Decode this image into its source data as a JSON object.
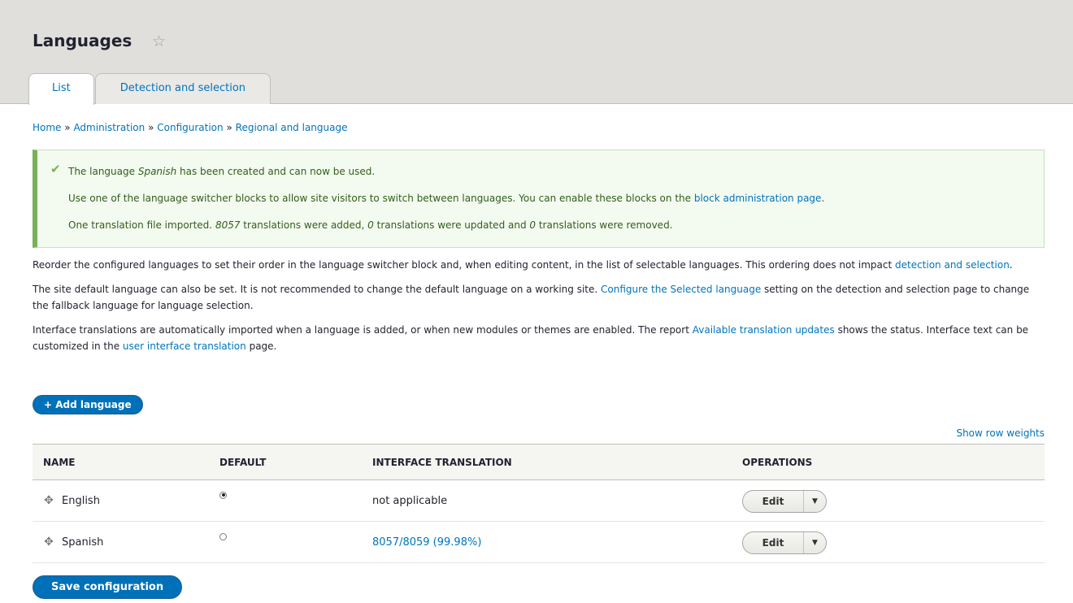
{
  "page": {
    "title": "Languages",
    "star_icon": "☆"
  },
  "tabs": [
    {
      "label": "List",
      "active": true
    },
    {
      "label": "Detection and selection",
      "active": false
    }
  ],
  "breadcrumb": [
    {
      "label": "Home"
    },
    {
      "label": "Administration"
    },
    {
      "label": "Configuration"
    },
    {
      "label": "Regional and language"
    }
  ],
  "breadcrumb_separator": "»",
  "message": {
    "icon": "check-icon",
    "line1_pre": "The language ",
    "line1_lang": "Spanish",
    "line1_post": " has been created and can now be used.",
    "line2_pre": "Use one of the language switcher blocks to allow site visitors to switch between languages. You can enable these blocks on the ",
    "line2_link": "block administration page",
    "line2_post": ".",
    "line3_a": "One translation file imported. ",
    "line3_added": "8057",
    "line3_b": " translations were added, ",
    "line3_updated": "0",
    "line3_c": " translations were updated and ",
    "line3_removed": "0",
    "line3_d": " translations were removed."
  },
  "intro": {
    "p1_text": "Reorder the configured languages to set their order in the language switcher block and, when editing content, in the list of selectable languages. This ordering does not impact ",
    "p1_link": "detection and selection",
    "p1_end": ".",
    "p2_text": "The site default language can also be set. It is not recommended to change the default language on a working site. ",
    "p2_link": "Configure the Selected language",
    "p2_end": " setting on the detection and selection page to change the fallback language for language selection.",
    "p3_text": "Interface translations are automatically imported when a language is added, or when new modules or themes are enabled. The report ",
    "p3_link": "Available translation updates",
    "p3_mid": " shows the status. Interface text can be customized in the ",
    "p3_link2": "user interface translation",
    "p3_end": " page."
  },
  "add_language_label": "+ Add language",
  "show_row_weights_label": "Show row weights",
  "table": {
    "headers": [
      "NAME",
      "DEFAULT",
      "INTERFACE TRANSLATION",
      "OPERATIONS"
    ],
    "rows": [
      {
        "name": "English",
        "is_default": true,
        "translation": "not applicable",
        "translation_is_link": false,
        "op_label": "Edit"
      },
      {
        "name": "Spanish",
        "is_default": false,
        "translation": "8057/8059 (99.98%)",
        "translation_is_link": true,
        "op_label": "Edit"
      }
    ],
    "drag_icon": "✥",
    "dropdown_arrow": "▼"
  },
  "save_label": "Save configuration"
}
